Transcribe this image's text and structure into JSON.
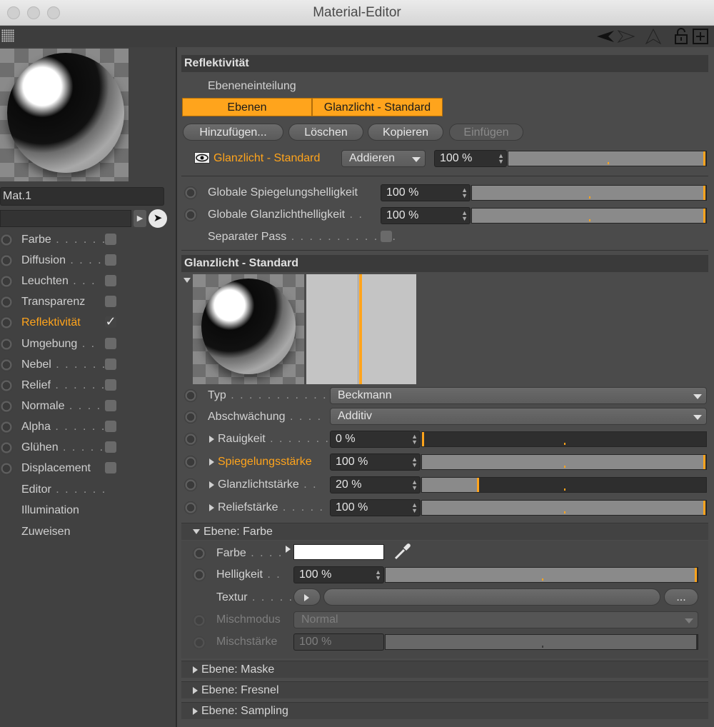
{
  "window": {
    "title": "Material-Editor"
  },
  "toolbar": {
    "icons": [
      "grip-icon",
      "back-arrow-icon",
      "forward-arrow-icon",
      "up-arrow-icon",
      "lock-icon",
      "new-window-icon"
    ]
  },
  "material": {
    "name": "Mat.1"
  },
  "channels": [
    {
      "label": "Farbe",
      "dots": " . . . . . .",
      "checked": false,
      "active": false
    },
    {
      "label": "Diffusion",
      "dots": " . . . .",
      "checked": false,
      "active": false
    },
    {
      "label": "Leuchten",
      "dots": " . . .",
      "checked": false,
      "active": false
    },
    {
      "label": "Transparenz",
      "dots": "",
      "checked": false,
      "active": false
    },
    {
      "label": "Reflektivität",
      "dots": "",
      "checked": true,
      "active": true
    },
    {
      "label": "Umgebung",
      "dots": " . .",
      "checked": false,
      "active": false
    },
    {
      "label": "Nebel",
      "dots": " . . . . . .",
      "checked": false,
      "active": false
    },
    {
      "label": "Relief",
      "dots": " . . . . . .",
      "checked": false,
      "active": false
    },
    {
      "label": "Normale",
      "dots": " . . . .",
      "checked": false,
      "active": false
    },
    {
      "label": "Alpha",
      "dots": " . . . . . .",
      "checked": false,
      "active": false
    },
    {
      "label": "Glühen",
      "dots": " . . . . .",
      "checked": false,
      "active": false
    },
    {
      "label": "Displacement",
      "dots": "",
      "checked": false,
      "active": false
    }
  ],
  "extra_items": [
    "Editor",
    "Illumination",
    "Zuweisen"
  ],
  "extra_dots": [
    " . . . . . .",
    "",
    ""
  ],
  "reflectivity": {
    "header": "Reflektivität",
    "layer_label": "Ebeneneinteilung",
    "seg_left": "Ebenen",
    "seg_right": "Glanzlicht - Standard",
    "buttons": {
      "add": "Hinzufügen...",
      "delete": "Löschen",
      "copy": "Kopieren",
      "paste": "Einfügen"
    },
    "layer_name": "Glanzlicht - Standard",
    "blend_mode": "Addieren",
    "layer_opacity": "100 %",
    "layer_opacity_value": 1.0,
    "global_reflection_label": "Globale Spiegelungshelligkeit",
    "global_reflection": "100 %",
    "global_reflection_value": 1.0,
    "global_specular_label": "Globale Glanzlichthelligkeit",
    "global_specular_dots": " . .",
    "global_specular": "100 %",
    "global_specular_value": 1.0,
    "separate_pass_label": "Separater Pass",
    "separate_pass_dots": " . . . . . . . . . . . .",
    "separate_pass": false
  },
  "specular": {
    "header": "Glanzlicht - Standard",
    "type_label": "Typ",
    "type_dots": " . . . . . . . . . . . . . . .",
    "type": "Beckmann",
    "attenuation_label": "Abschwächung",
    "attenuation_dots": " . . . .",
    "attenuation": "Additiv",
    "roughness_label": "Rauigkeit",
    "roughness_dots": " . . . . . . . .",
    "roughness": "0 %",
    "roughness_value": 0.0,
    "reflection_strength_label": "Spiegelungsstärke",
    "reflection_strength": "100 %",
    "reflection_strength_value": 1.0,
    "specular_strength_label": "Glanzlichtstärke",
    "specular_strength_dots": " . .",
    "specular_strength": "20 %",
    "specular_strength_value": 0.2,
    "bump_strength_label": "Reliefstärke",
    "bump_strength_dots": " . . . . .",
    "bump_strength": "100 %",
    "bump_strength_value": 1.0
  },
  "layer_color": {
    "header": "Ebene: Farbe",
    "color_label": "Farbe",
    "color_dots": " . . . .",
    "color": "#ffffff",
    "brightness_label": "Helligkeit",
    "brightness_dots": " . .",
    "brightness": "100 %",
    "brightness_value": 1.0,
    "texture_label": "Textur",
    "texture_dots": " . . . . .",
    "texture_more": "...",
    "blend_mode_label": "Mischmodus",
    "blend_mode": "Normal",
    "blend_strength_label": "Mischstärke",
    "blend_strength": "100 %",
    "blend_strength_value": 1.0
  },
  "collapsed_layers": [
    "Ebene: Maske",
    "Ebene: Fresnel",
    "Ebene: Sampling"
  ]
}
